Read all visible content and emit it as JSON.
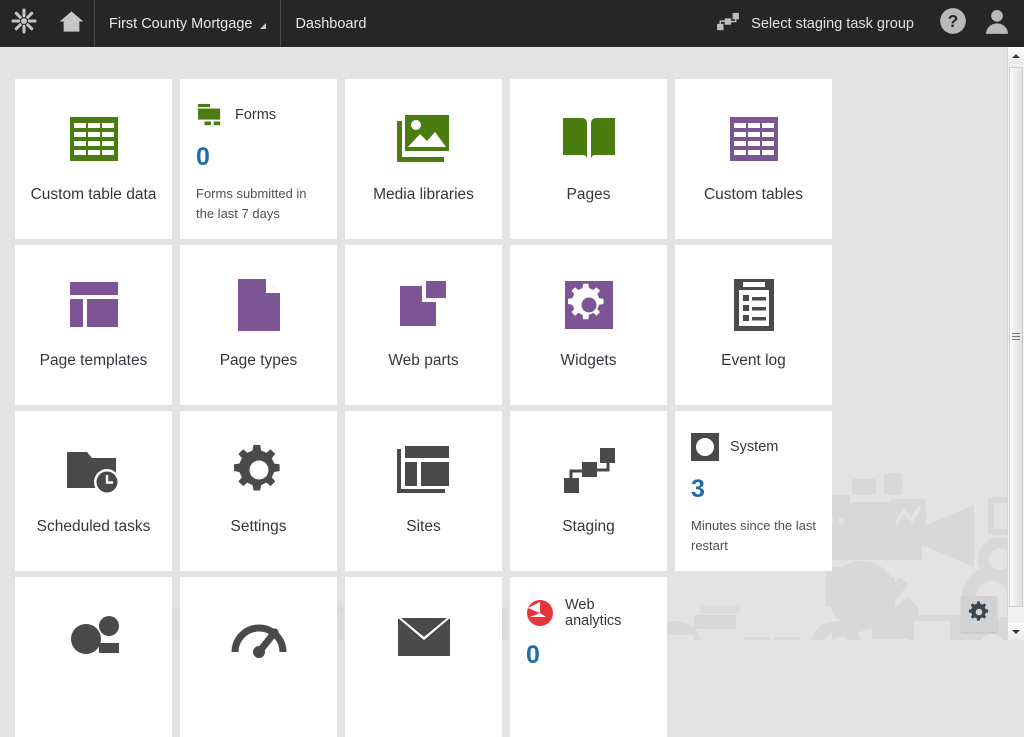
{
  "header": {
    "logo_icon": "kentico-asterisk-icon",
    "home_icon": "home-icon",
    "site_name": "First County Mortgage",
    "section": "Dashboard",
    "staging_label": "Select staging task group",
    "staging_icon": "staging-nodes-icon",
    "help_icon": "question-mark-icon",
    "user_icon": "user-avatar-icon"
  },
  "colors": {
    "header_bg": "#262626",
    "page_bg": "#e3e3e3",
    "tile_bg": "#ffffff",
    "green": "#4a7c10",
    "purple": "#7d5594",
    "dark_gray": "#4a4a4a",
    "blue_value": "#1f6ea5",
    "red": "#e8343a",
    "label_text": "#31373c"
  },
  "tiles": [
    {
      "kind": "nav",
      "name": "custom-table-data",
      "label": "Custom table data",
      "icon": "table-grid-icon",
      "color": "#4a7c10"
    },
    {
      "kind": "widget",
      "name": "forms",
      "title": "Forms",
      "value": "0",
      "caption": "Forms submitted in the last 7 days",
      "icon": "forms-icon",
      "color": "#4a7c10"
    },
    {
      "kind": "nav",
      "name": "media-libraries",
      "label": "Media libraries",
      "icon": "image-photo-icon",
      "color": "#4a7c10"
    },
    {
      "kind": "nav",
      "name": "pages",
      "label": "Pages",
      "icon": "open-book-icon",
      "color": "#4a7c10"
    },
    {
      "kind": "nav",
      "name": "custom-tables",
      "label": "Custom tables",
      "icon": "table-grid-icon",
      "color": "#7d5594"
    },
    {
      "kind": "nav",
      "name": "page-templates",
      "label": "Page templates",
      "icon": "layout-template-icon",
      "color": "#7d5594"
    },
    {
      "kind": "nav",
      "name": "page-types",
      "label": "Page types",
      "icon": "document-page-icon",
      "color": "#7d5594"
    },
    {
      "kind": "nav",
      "name": "web-parts",
      "label": "Web parts",
      "icon": "web-parts-blocks-icon",
      "color": "#7d5594"
    },
    {
      "kind": "nav",
      "name": "widgets",
      "label": "Widgets",
      "icon": "gear-square-icon",
      "color": "#7d5594"
    },
    {
      "kind": "nav",
      "name": "event-log",
      "label": "Event log",
      "icon": "clipboard-list-icon",
      "color": "#4a4a4a"
    },
    {
      "kind": "nav",
      "name": "scheduled-tasks",
      "label": "Scheduled tasks",
      "icon": "folder-clock-icon",
      "color": "#4a4a4a"
    },
    {
      "kind": "nav",
      "name": "settings",
      "label": "Settings",
      "icon": "gear-icon",
      "color": "#4a4a4a"
    },
    {
      "kind": "nav",
      "name": "sites",
      "label": "Sites",
      "icon": "layout-sites-icon",
      "color": "#4a4a4a"
    },
    {
      "kind": "nav",
      "name": "staging",
      "label": "Staging",
      "icon": "staging-nodes-icon",
      "color": "#4a4a4a"
    },
    {
      "kind": "widget",
      "name": "system",
      "title": "System",
      "value": "3",
      "caption": "Minutes since the last restart",
      "icon": "system-circle-icon",
      "color": "#4a4a4a"
    },
    {
      "kind": "nav",
      "name": "users",
      "label": "",
      "icon": "users-people-icon",
      "color": "#4a4a4a"
    },
    {
      "kind": "nav",
      "name": "performance",
      "label": "",
      "icon": "speedometer-icon",
      "color": "#4a4a4a"
    },
    {
      "kind": "nav",
      "name": "email-queue",
      "label": "",
      "icon": "envelope-mail-icon",
      "color": "#4a4a4a"
    },
    {
      "kind": "widget",
      "name": "web-analytics",
      "title": "Web analytics",
      "value": "0",
      "caption": "",
      "icon": "pie-chart-icon",
      "color": "#e8343a"
    }
  ],
  "scrollbar": {
    "up_icon": "scroll-up-arrow-icon",
    "down_icon": "scroll-down-arrow-icon",
    "thumb": "scrollbar-thumb"
  },
  "floating_button": {
    "icon": "gear-icon",
    "name": "dashboard-settings-gear"
  }
}
